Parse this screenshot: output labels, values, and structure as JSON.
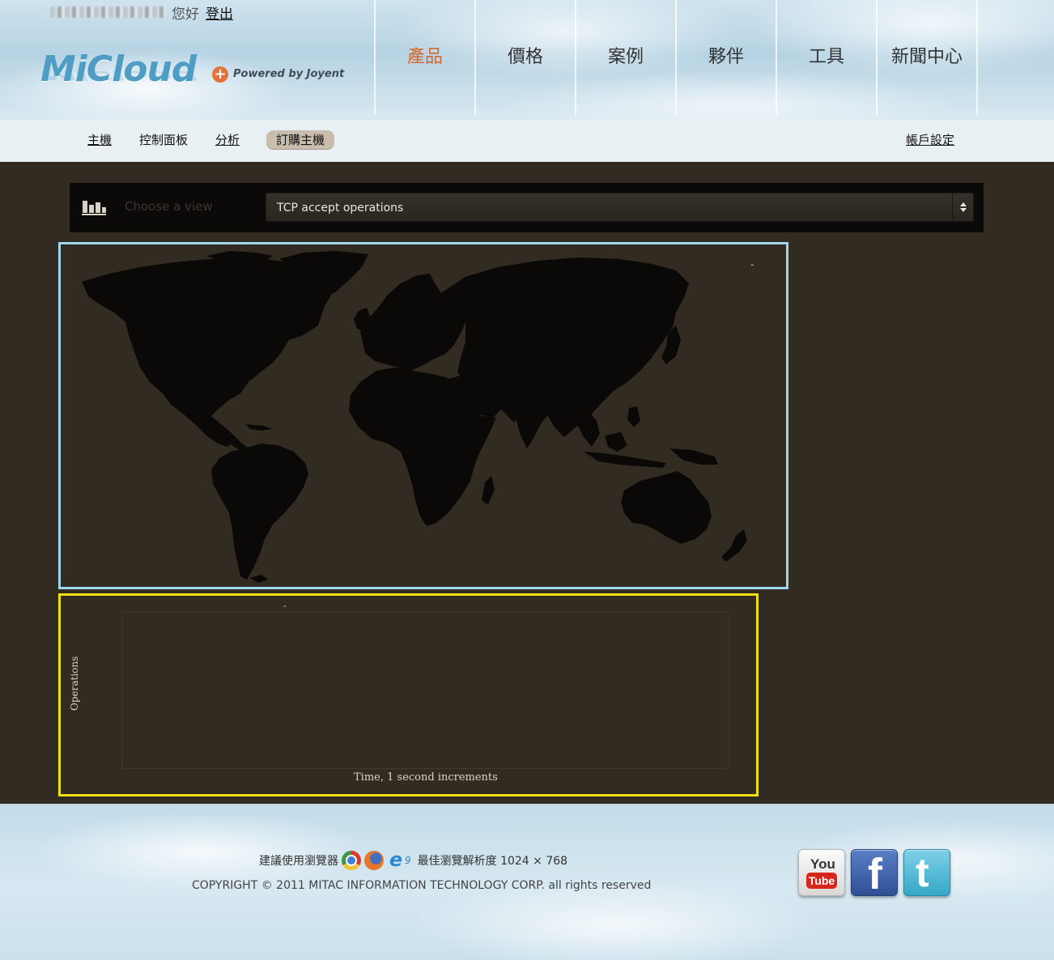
{
  "header": {
    "greeting": "您好",
    "logout_label": "登出",
    "logo_text": "MiCloud",
    "logo_tagline": "Powered by Joyent",
    "nav": [
      {
        "label": "產品",
        "active": true
      },
      {
        "label": "價格",
        "active": false
      },
      {
        "label": "案例",
        "active": false
      },
      {
        "label": "夥伴",
        "active": false
      },
      {
        "label": "工具",
        "active": false
      },
      {
        "label": "新聞中心",
        "active": false
      }
    ],
    "accent_color": "#d8652c"
  },
  "subnav": {
    "items": [
      {
        "label": "主機"
      },
      {
        "label": "控制面板"
      },
      {
        "label": "分析"
      },
      {
        "label": "訂購主機",
        "active": true
      }
    ],
    "account_label": "帳戶設定"
  },
  "view_chooser": {
    "icon": "bar-chart-icon",
    "label": "Choose a view",
    "selected": "TCP accept operations"
  },
  "map_panel": {
    "border_color": "#9fd6ec",
    "dash": "-"
  },
  "chart_panel": {
    "border_color": "#f0df14",
    "dash": "-"
  },
  "chart_data": {
    "type": "line",
    "title": "",
    "xlabel": "Time, 1 second increments",
    "ylabel": "Operations",
    "series": []
  },
  "footer": {
    "browser_prefix": "建議使用瀏覽器",
    "browser_icons": [
      "chrome-icon",
      "firefox-icon",
      "ie-icon"
    ],
    "ie_version": "9",
    "resolution_text": "最佳瀏覽解析度 1024 × 768",
    "copyright": "COPYRIGHT © 2011 MITAC INFORMATION TECHNOLOGY CORP. all rights reserved",
    "social": [
      {
        "name": "youtube",
        "top": "You",
        "bottom": "Tube"
      },
      {
        "name": "facebook",
        "glyph": "f"
      },
      {
        "name": "twitter",
        "glyph": "t"
      }
    ]
  }
}
